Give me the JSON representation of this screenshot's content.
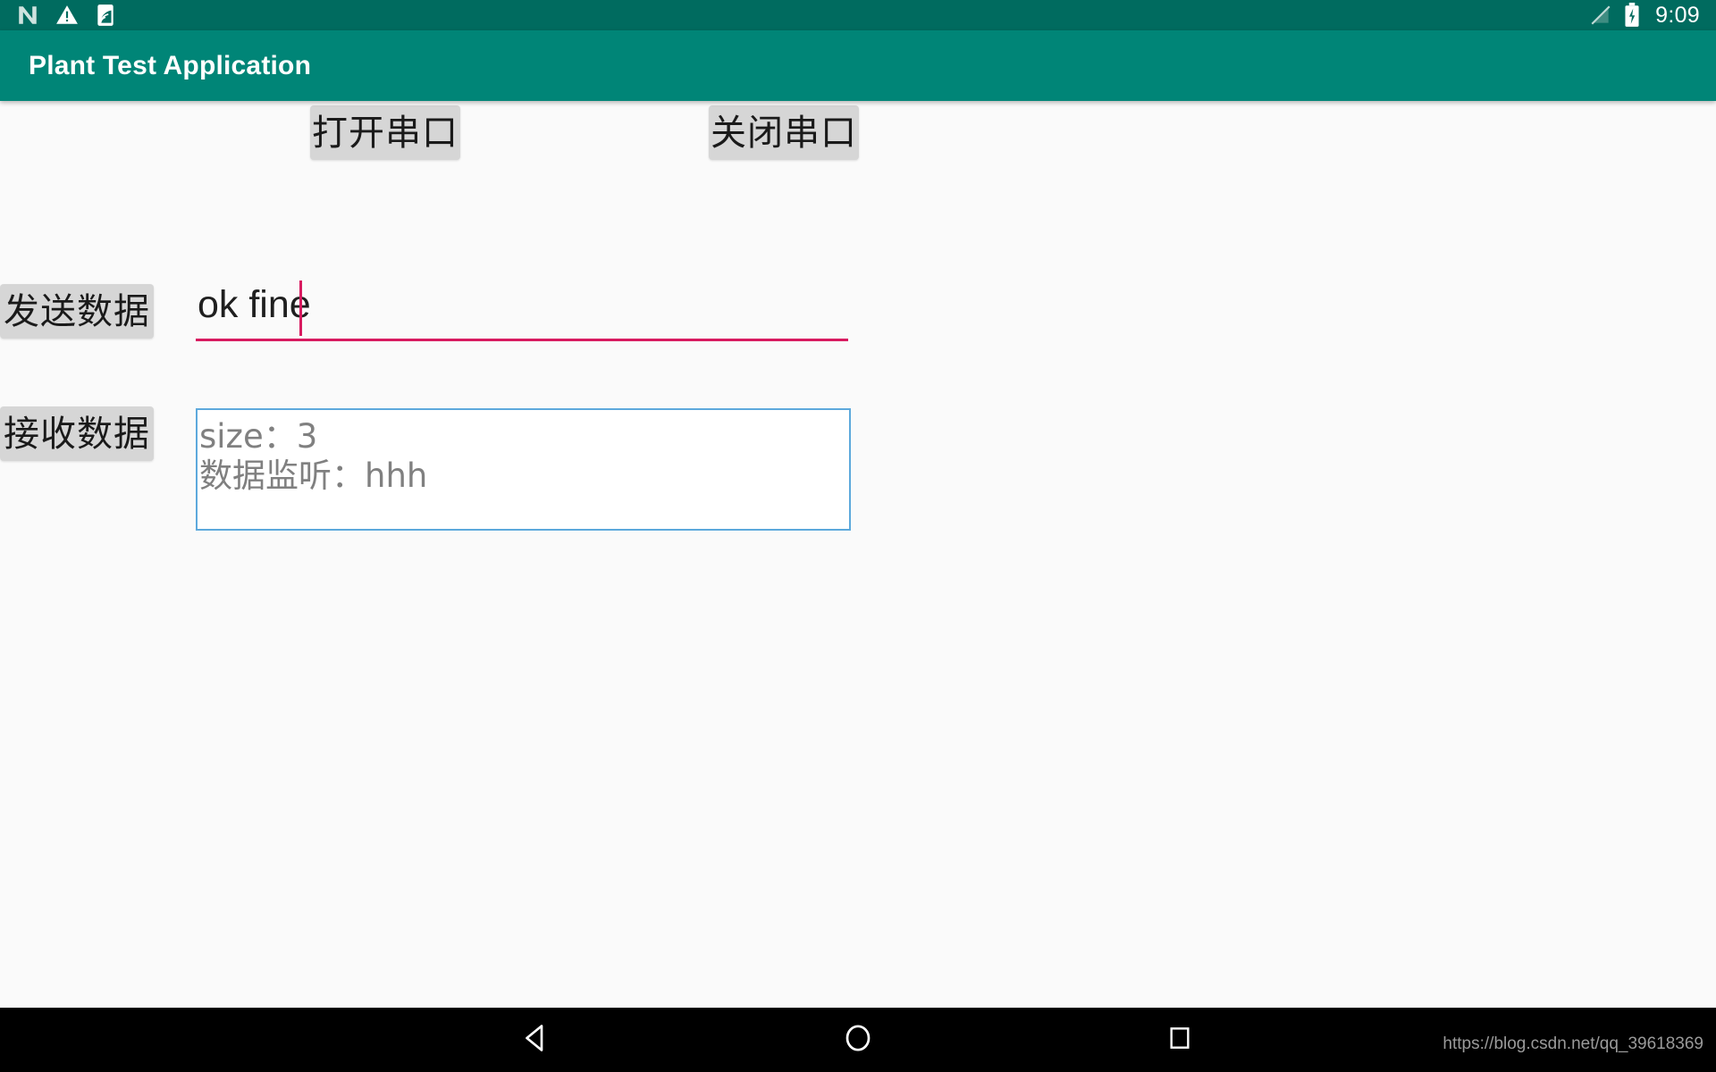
{
  "status_bar": {
    "icons_left": [
      "android-n-logo-icon",
      "warning-triangle-icon",
      "adb-tag-icon"
    ],
    "icons_right": [
      "signal-off-icon",
      "battery-charging-icon"
    ],
    "clock": "9:09",
    "background_color": "#006B5F"
  },
  "app_bar": {
    "title": "Plant Test Application",
    "background_color": "#008577",
    "text_color": "#FFFFFF"
  },
  "main": {
    "background_color": "#FAFAFA",
    "buttons": {
      "open_serial": "打开串口",
      "close_serial": "关闭串口",
      "send_data": "发送数据",
      "receive_data": "接收数据",
      "background_color": "#D6D6D6"
    },
    "send_input": {
      "value": "ok fine",
      "placeholder": "",
      "accent_color": "#D81B60"
    },
    "receive_output": {
      "line1": "size：3",
      "line2": "数据监听：hhh",
      "text": "size：3\n数据监听：hhh",
      "border_color": "#5DA9DC",
      "text_color": "#808080"
    }
  },
  "nav_bar": {
    "back": "back-triangle-icon",
    "home": "home-circle-icon",
    "recents": "recents-square-icon",
    "background_color": "#000000"
  },
  "watermark": {
    "text": "https://blog.csdn.net/qq_39618369"
  }
}
